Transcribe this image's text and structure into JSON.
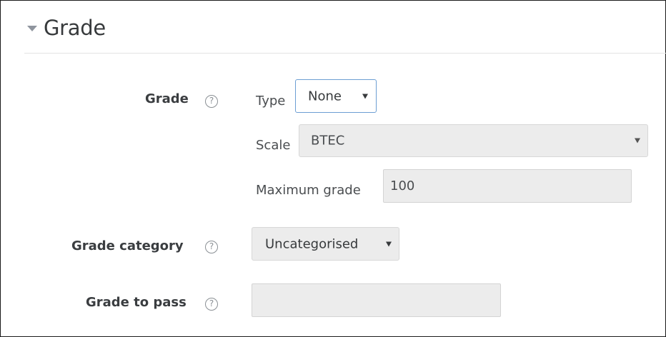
{
  "section": {
    "title": "Grade",
    "expand_icon": "collapse-caret-icon"
  },
  "fields": {
    "grade": {
      "label": "Grade",
      "help_icon": "help-icon",
      "help_glyph": "?",
      "type": {
        "label": "Type",
        "value": "None"
      },
      "scale": {
        "label": "Scale",
        "value": "BTEC"
      },
      "max_grade": {
        "label": "Maximum grade",
        "value": "100"
      }
    },
    "grade_category": {
      "label": "Grade category",
      "help_glyph": "?",
      "value": "Uncategorised"
    },
    "grade_to_pass": {
      "label": "Grade to pass",
      "help_glyph": "?",
      "value": ""
    }
  },
  "colors": {
    "field_bg": "#ececec",
    "focus_border": "#6c9ed3",
    "text": "#373a3c"
  }
}
